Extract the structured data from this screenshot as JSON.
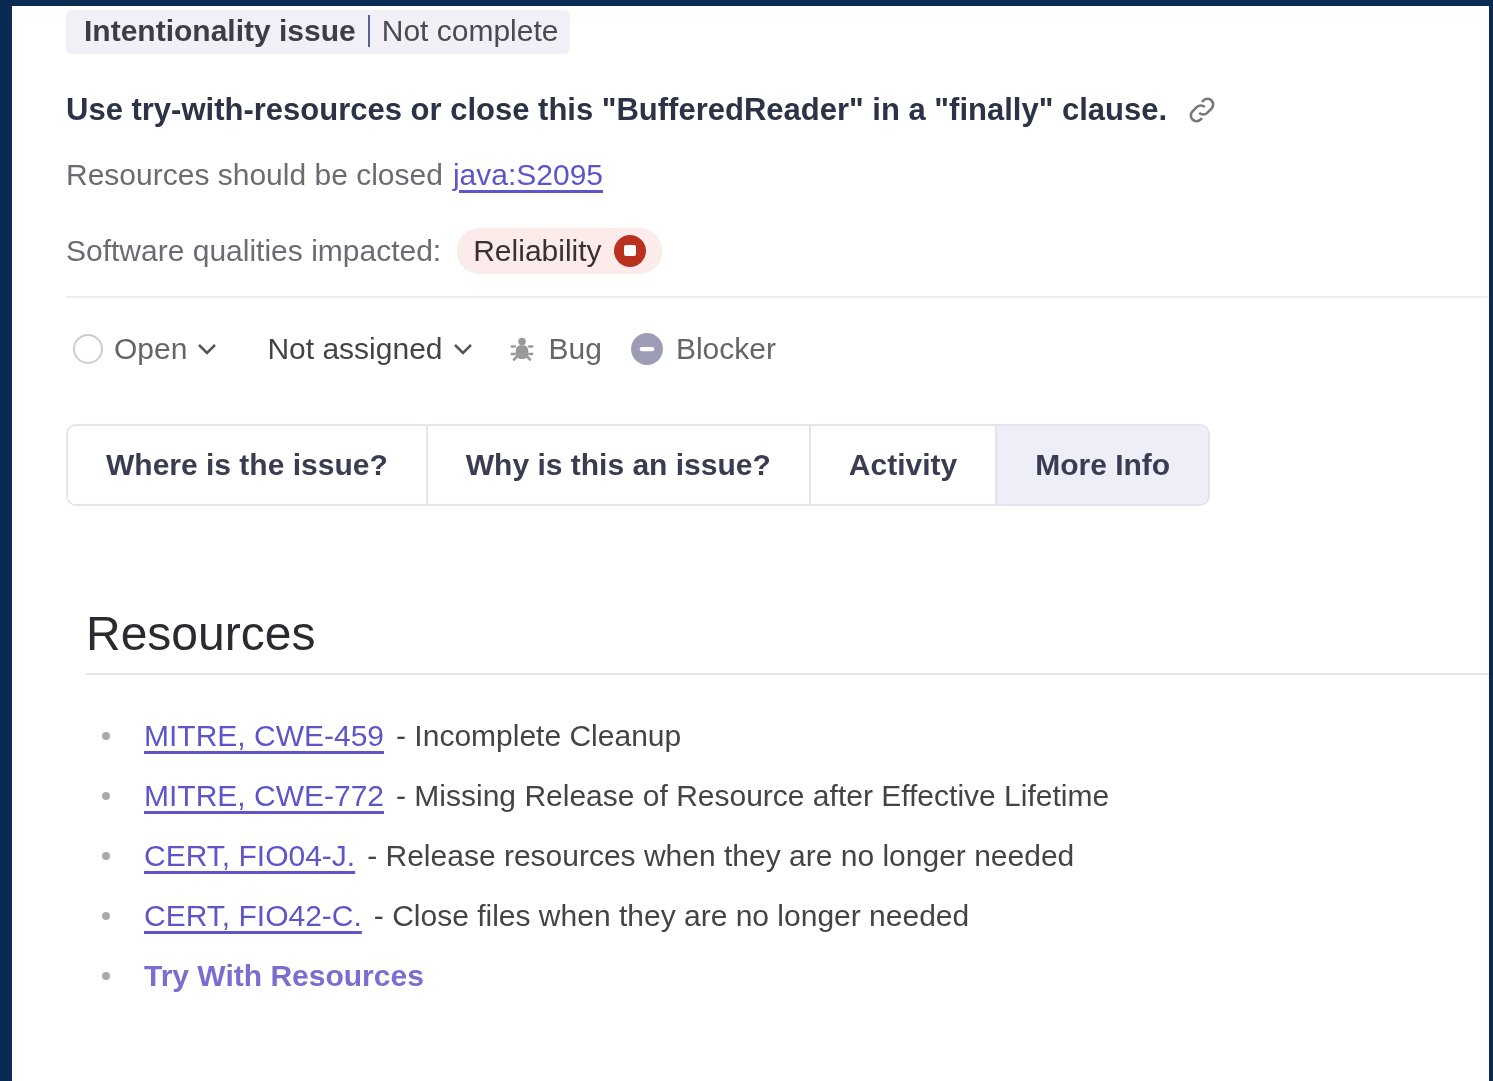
{
  "header": {
    "attribute": "Intentionality issue",
    "status": "Not complete"
  },
  "title": "Use try-with-resources or close this \"BufferedReader\" in a \"finally\" clause.",
  "rule": {
    "text": "Resources should be closed",
    "key": "java:S2095"
  },
  "qualities": {
    "label": "Software qualities impacted:",
    "items": [
      {
        "name": "Reliability",
        "color": "#b8321f"
      }
    ]
  },
  "status_row": {
    "status": "Open",
    "assignee": "Not assigned",
    "type": "Bug",
    "severity": "Blocker"
  },
  "tabs": [
    {
      "label": "Where is the issue?",
      "selected": false
    },
    {
      "label": "Why is this an issue?",
      "selected": false
    },
    {
      "label": "Activity",
      "selected": false
    },
    {
      "label": "More Info",
      "selected": true
    }
  ],
  "resources": {
    "heading": "Resources",
    "items": [
      {
        "link": "MITRE, CWE-459",
        "description": "- Incomplete Cleanup"
      },
      {
        "link": "MITRE, CWE-772",
        "description": "- Missing Release of Resource after Effective Lifetime"
      },
      {
        "link": "CERT, FIO04-J.",
        "description": "- Release resources when they are no longer needed"
      },
      {
        "link": "CERT, FIO42-C.",
        "description": "- Close files when they are no longer needed"
      },
      {
        "link": "Try With Resources"
      }
    ]
  }
}
